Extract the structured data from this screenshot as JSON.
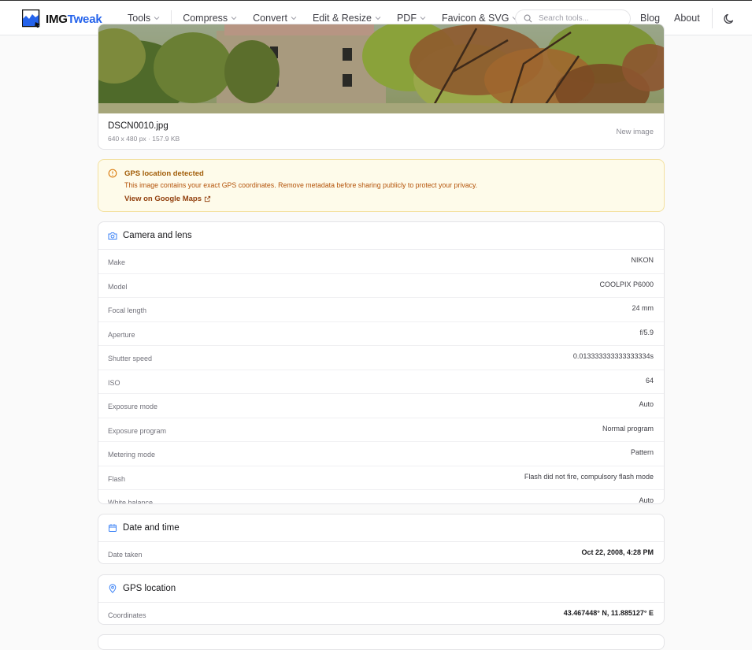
{
  "app": {
    "brand_prefix": "IMG",
    "brand_suffix": "Tweak"
  },
  "nav": [
    {
      "label": "Tools"
    },
    {
      "label": "Compress"
    },
    {
      "label": "Convert"
    },
    {
      "label": "Edit & Resize"
    },
    {
      "label": "PDF"
    },
    {
      "label": "Favicon & SVG"
    }
  ],
  "search": {
    "placeholder": "Search tools..."
  },
  "header_links": {
    "blog": "Blog",
    "about": "About"
  },
  "image": {
    "filename": "DSCN0010.jpg",
    "meta": "640 x 480 px · 157.9 KB",
    "new_image": "New image"
  },
  "gps_warning": {
    "title": "GPS location detected",
    "text": "This image contains your exact GPS coordinates. Remove metadata before sharing publicly to protect your privacy.",
    "link": "View on Google Maps"
  },
  "camera": {
    "title": "Camera and lens",
    "rows": [
      {
        "key": "Make",
        "value": "NIKON"
      },
      {
        "key": "Model",
        "value": "COOLPIX P6000"
      },
      {
        "key": "Focal length",
        "value": "24 mm"
      },
      {
        "key": "Aperture",
        "value": "f/5.9"
      },
      {
        "key": "Shutter speed",
        "value": "0.013333333333333334s"
      },
      {
        "key": "ISO",
        "value": "64"
      },
      {
        "key": "Exposure mode",
        "value": "Auto"
      },
      {
        "key": "Exposure program",
        "value": "Normal program"
      },
      {
        "key": "Metering mode",
        "value": "Pattern"
      },
      {
        "key": "Flash",
        "value": "Flash did not fire, compulsory flash mode"
      },
      {
        "key": "White balance",
        "value": "Auto"
      }
    ]
  },
  "datetime": {
    "title": "Date and time",
    "rows": [
      {
        "key": "Date taken",
        "value": "Oct 22, 2008, 4:28 PM"
      }
    ]
  },
  "gps": {
    "title": "GPS location",
    "rows": [
      {
        "key": "Coordinates",
        "value": "43.467448° N, 11.885127° E"
      }
    ]
  },
  "colors": {
    "accent": "#2563eb",
    "warning_bg": "#fefbea",
    "warning_text": "#b45309"
  },
  "icons": [
    "search-icon",
    "moon-icon",
    "chevron-down-icon",
    "alert-circle-icon",
    "external-link-icon",
    "camera-icon",
    "calendar-icon",
    "map-pin-icon"
  ]
}
